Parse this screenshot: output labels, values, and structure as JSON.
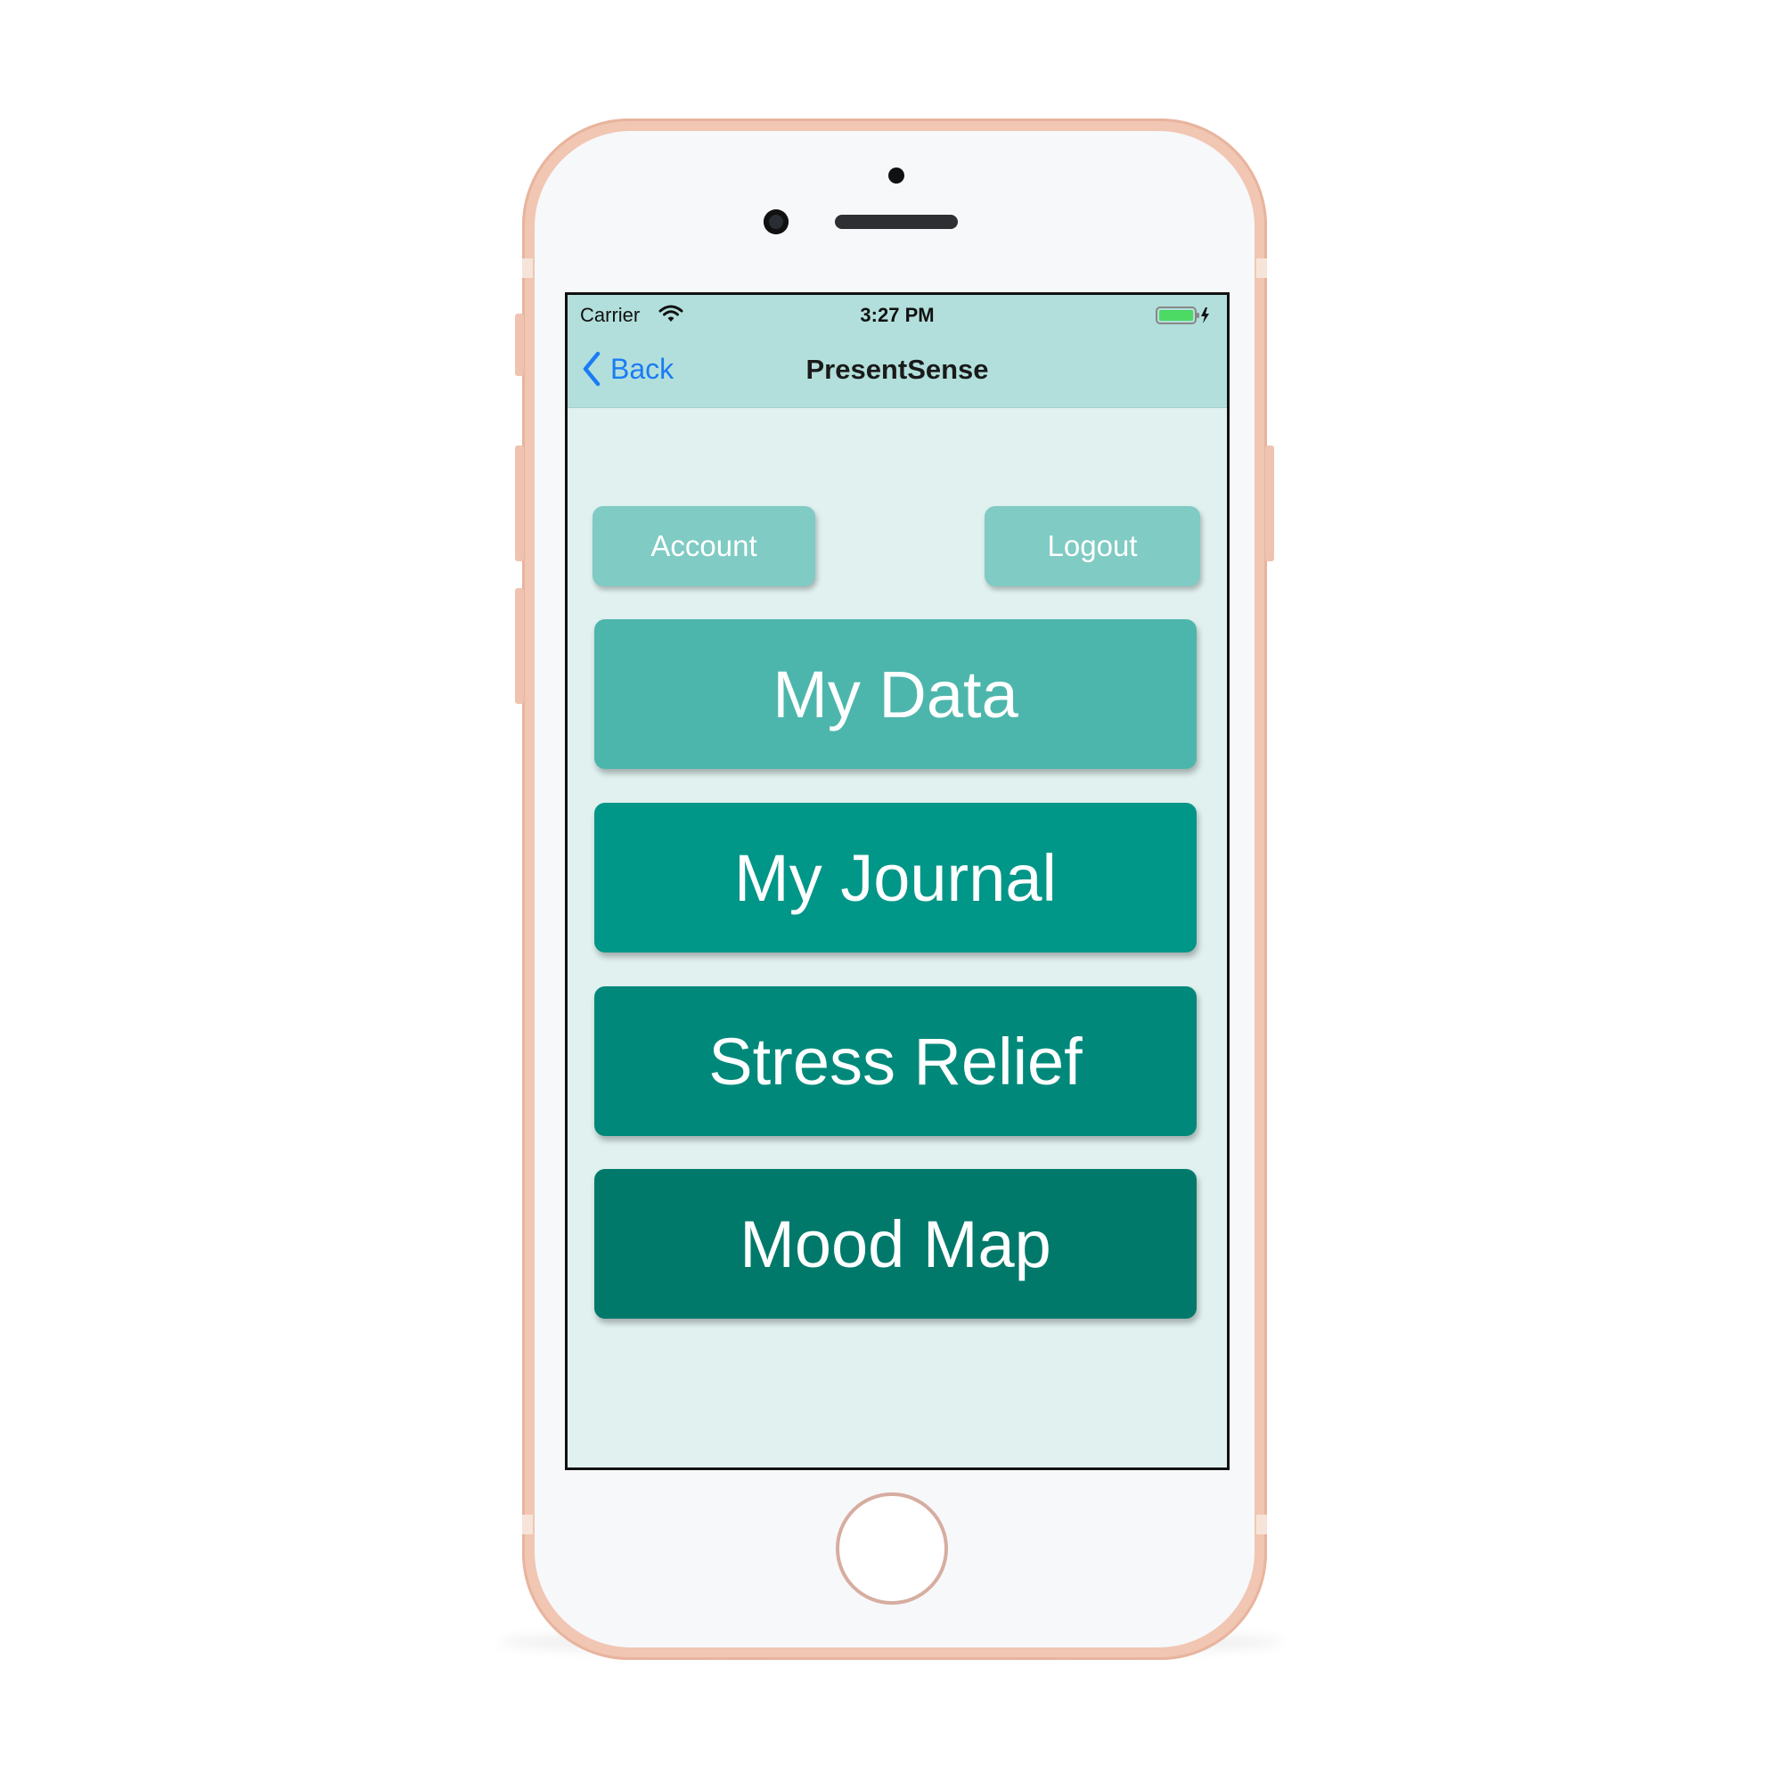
{
  "status_bar": {
    "carrier": "Carrier",
    "time": "3:27 PM",
    "wifi_icon": "wifi-icon",
    "battery_icon": "battery-charging-icon"
  },
  "nav_bar": {
    "back_label": "Back",
    "title": "PresentSense"
  },
  "top_buttons": {
    "account_label": "Account",
    "logout_label": "Logout"
  },
  "menu": {
    "items": [
      {
        "label": "My Data",
        "color": "#4db6ac"
      },
      {
        "label": "My Journal",
        "color": "#009688"
      },
      {
        "label": "Stress Relief",
        "color": "#00897b"
      },
      {
        "label": "Mood Map",
        "color": "#00796b"
      }
    ]
  },
  "colors": {
    "screen_background": "#e0f1f0",
    "nav_background": "#b2dfdb",
    "small_button": "#80cbc4",
    "back_link": "#1a7cf5",
    "battery_fill": "#4cd964"
  }
}
